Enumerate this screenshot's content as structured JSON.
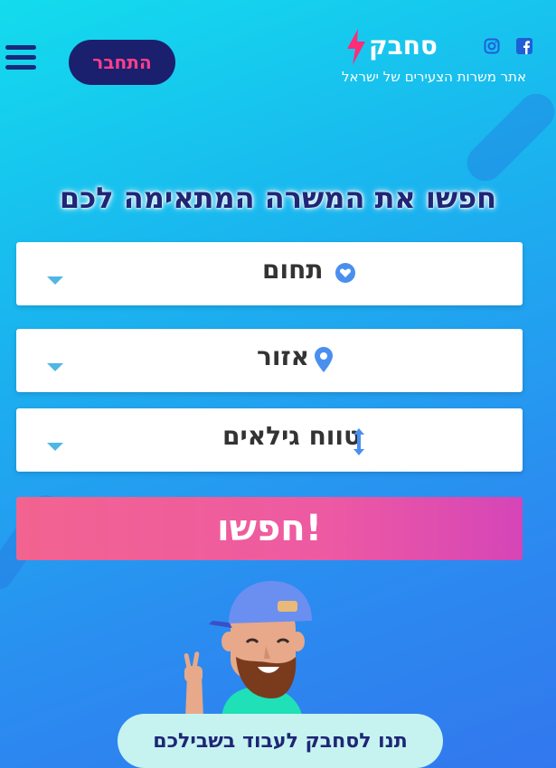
{
  "header": {
    "brand_name": "סחבק",
    "tagline": "אתר משרות הצעירים של ישראל",
    "login_label": "התחבר",
    "social": [
      "facebook-icon",
      "instagram-icon"
    ]
  },
  "search": {
    "title": "חפשו את המשרה המתאימה לכם",
    "field_label": "תחום",
    "area_label": "אזור",
    "age_label": "טווח גילאים",
    "submit_label": "חפשו!"
  },
  "cta": {
    "label": "תנו לסחבק לעבוד בשבילכם"
  },
  "colors": {
    "primary_dark": "#1f2675",
    "accent_pink": "#ff3e8a",
    "button_gradient_start": "#f26390",
    "button_gradient_end": "#d545b8",
    "icon_blue": "#4a8ff0"
  }
}
